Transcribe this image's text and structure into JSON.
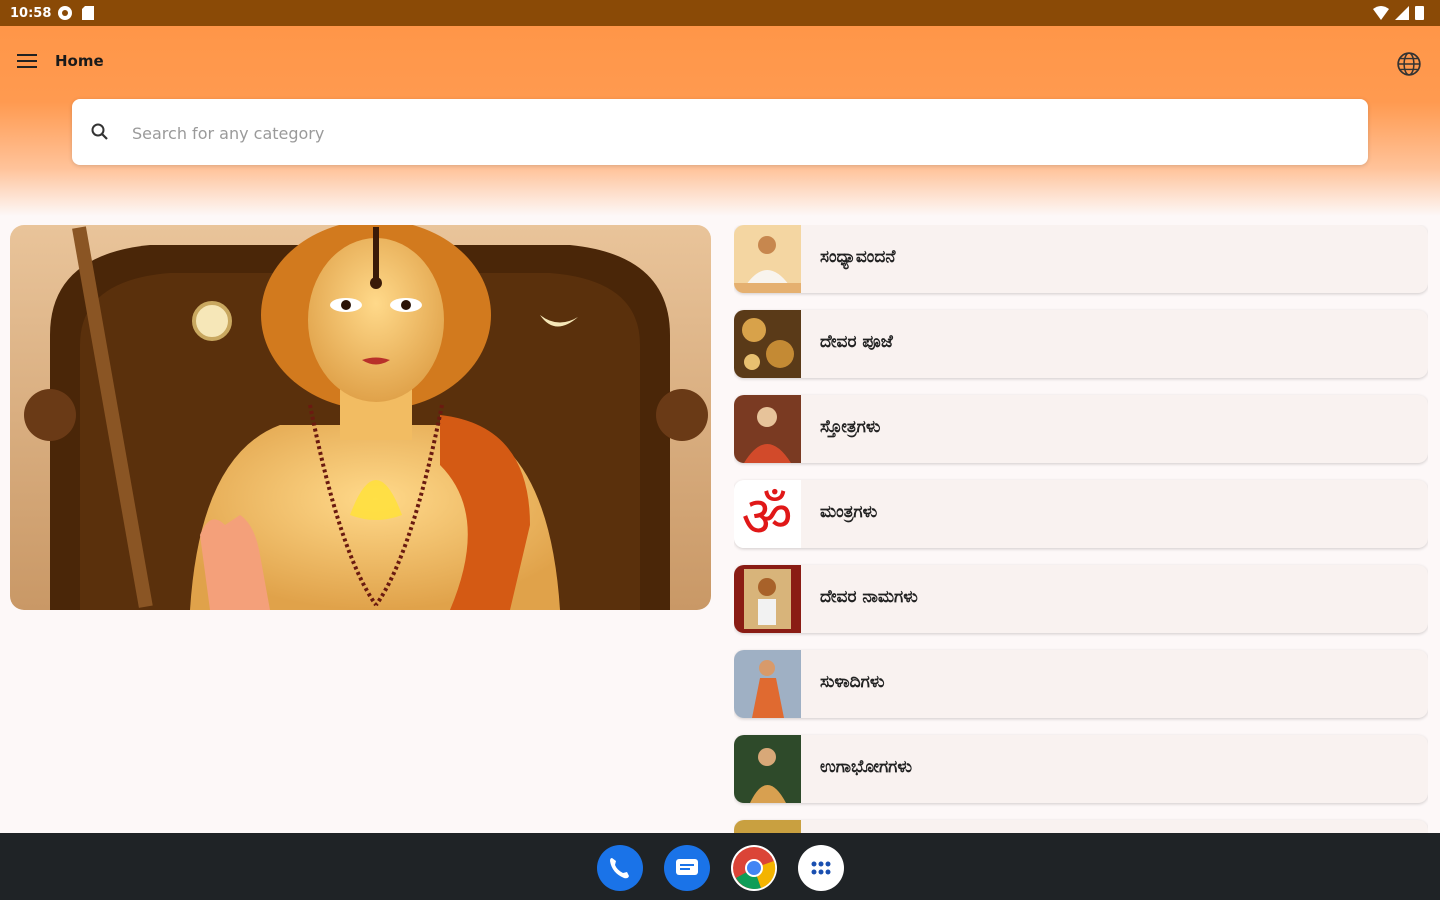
{
  "status_bar": {
    "time": "10:58"
  },
  "header": {
    "title": "Home",
    "menu_icon": "hamburger-menu-icon",
    "language_icon": "globe-icon"
  },
  "search": {
    "placeholder": "Search for any category",
    "value": ""
  },
  "categories": [
    {
      "label": "ಸಂಧ್ಯಾವಂದನೆ"
    },
    {
      "label": "ದೇವರ ಪೂಜೆ"
    },
    {
      "label": "ಸ್ತೋತ್ರಗಳು"
    },
    {
      "label": "ಮಂತ್ರಗಳು"
    },
    {
      "label": "ದೇವರ ನಾಮಗಳು"
    },
    {
      "label": "ಸುಳಾದಿಗಳು"
    },
    {
      "label": "ಉಗಾಭೋಗಗಳು"
    }
  ],
  "dock": [
    "phone-icon",
    "messages-icon",
    "chrome-icon",
    "app-drawer-icon"
  ],
  "colors": {
    "status_bar": "#8a4a06",
    "header_orange": "#ff9648",
    "card_bg": "#f9f2f0",
    "nav_bar": "#1f2326"
  }
}
